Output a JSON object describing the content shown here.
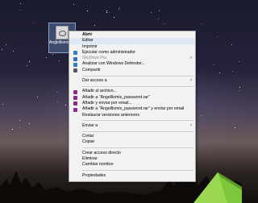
{
  "desktop_icon": {
    "label": "Angelllomis_password"
  },
  "context_menu": {
    "items": [
      {
        "label": "Abrir",
        "bold": true,
        "icon": null,
        "submenu": false
      },
      {
        "label": "Editar",
        "highlight": true,
        "icon": null,
        "submenu": false
      },
      {
        "label": "Imprimir",
        "icon": null,
        "submenu": false
      },
      {
        "label": "Ejecutar como administrador",
        "icon": "shield-icon",
        "icon_color": "#3a78c8",
        "submenu": false
      },
      {
        "label": "SkyDrive Pro",
        "icon": "cloud-icon",
        "icon_color": "#2f6fc0",
        "submenu": true,
        "disabled": true
      },
      {
        "label": "Analizar con Windows Defender...",
        "icon": "defender-icon",
        "icon_color": "#2e7fbf",
        "submenu": false
      },
      {
        "label": "Compartir",
        "icon": "share-icon",
        "icon_color": "#5a5a5a",
        "submenu": false
      },
      {
        "separator": true
      },
      {
        "label": "Dar acceso a",
        "icon": null,
        "submenu": true
      },
      {
        "separator": true
      },
      {
        "label": "Añadir al archivo...",
        "icon": "winrar-icon",
        "icon_color": "#8b2a8a",
        "submenu": false
      },
      {
        "label": "Añadir a \"Angelllomis_password.rar\"",
        "icon": "winrar-icon",
        "icon_color": "#8b2a8a",
        "submenu": false
      },
      {
        "label": "Añadir y enviar por email...",
        "icon": "winrar-icon",
        "icon_color": "#8b2a8a",
        "submenu": false
      },
      {
        "label": "Añadir a \"Angelllomis_password.rar\" y enviar por email",
        "icon": "winrar-icon",
        "icon_color": "#8b2a8a",
        "submenu": false
      },
      {
        "label": "Restaurar versiones anteriores",
        "icon": null,
        "submenu": false
      },
      {
        "separator": true
      },
      {
        "label": "Enviar a",
        "icon": null,
        "submenu": true
      },
      {
        "separator": true
      },
      {
        "label": "Cortar",
        "icon": null,
        "submenu": false
      },
      {
        "label": "Copiar",
        "icon": null,
        "submenu": false
      },
      {
        "separator": true
      },
      {
        "label": "Crear acceso directo",
        "icon": null,
        "submenu": false
      },
      {
        "label": "Eliminar",
        "icon": null,
        "submenu": false
      },
      {
        "label": "Cambiar nombre",
        "icon": null,
        "submenu": false
      },
      {
        "separator": true
      },
      {
        "label": "Propiedades",
        "icon": null,
        "submenu": false
      }
    ]
  },
  "colors": {
    "menu_background": "#f2f2f2",
    "highlight": "#dfe8f4",
    "tent": "#7ec63a"
  }
}
